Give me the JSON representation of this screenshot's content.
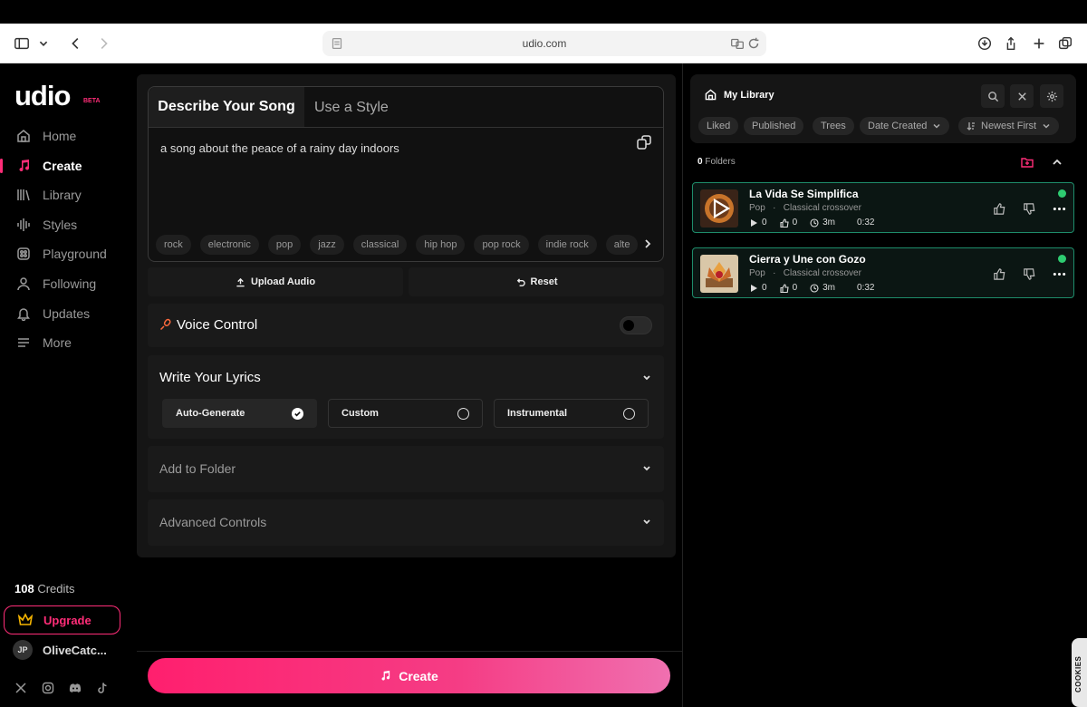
{
  "browser": {
    "url": "udio.com"
  },
  "brand": {
    "logo": "udio",
    "badge": "BETA",
    "accent": "#ff2d78"
  },
  "sidebar": {
    "items": [
      {
        "label": "Home",
        "icon": "home-icon"
      },
      {
        "label": "Create",
        "icon": "music-note-icon",
        "active": true
      },
      {
        "label": "Library",
        "icon": "library-icon"
      },
      {
        "label": "Styles",
        "icon": "waveform-icon"
      },
      {
        "label": "Playground",
        "icon": "playground-icon"
      },
      {
        "label": "Following",
        "icon": "user-icon"
      },
      {
        "label": "Updates",
        "icon": "bell-icon"
      },
      {
        "label": "More",
        "icon": "menu-icon"
      }
    ],
    "credits_count": "108",
    "credits_label": "Credits",
    "upgrade_label": "Upgrade",
    "user_initials": "JP",
    "user_name": "OliveCatc..."
  },
  "create": {
    "tabs": [
      "Describe Your Song",
      "Use a Style"
    ],
    "prompt": "a song about the peace of a rainy day indoors",
    "tags": [
      "rock",
      "electronic",
      "pop",
      "jazz",
      "classical",
      "hip hop",
      "pop rock",
      "indie rock",
      "alte"
    ],
    "upload_label": "Upload Audio",
    "reset_label": "Reset",
    "voice_control": {
      "title": "Voice Control",
      "enabled": false
    },
    "lyrics": {
      "title": "Write Your Lyrics",
      "options": [
        "Auto-Generate",
        "Custom",
        "Instrumental"
      ],
      "selected": "Auto-Generate"
    },
    "add_to_folder": "Add to Folder",
    "advanced_controls": "Advanced Controls",
    "create_label": "Create"
  },
  "library": {
    "title": "My Library",
    "filters": [
      "Liked",
      "Published",
      "Trees",
      "Date Created",
      "Newest First"
    ],
    "folders_count": "0",
    "folders_label": "Folders",
    "songs": [
      {
        "title": "La Vida Se Simplifica",
        "genre": "Pop",
        "subgenre": "Classical crossover",
        "plays": "0",
        "likes": "0",
        "age": "3m",
        "duration": "0:32"
      },
      {
        "title": "Cierra y Une con Gozo",
        "genre": "Pop",
        "subgenre": "Classical crossover",
        "plays": "0",
        "likes": "0",
        "age": "3m",
        "duration": "0:32"
      }
    ]
  },
  "cookies_label": "COOKIES"
}
